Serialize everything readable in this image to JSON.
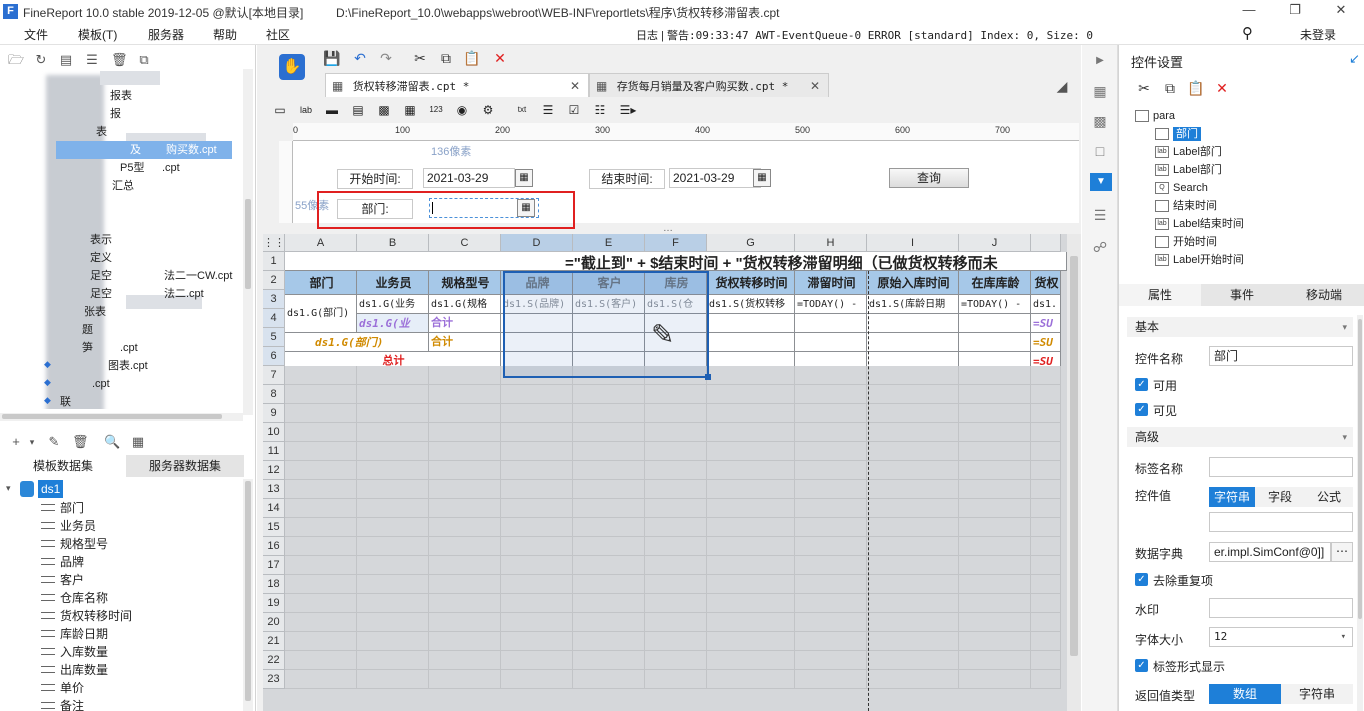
{
  "window": {
    "title": "FineReport 10.0 stable 2019-12-05 @默认[本地目录]",
    "path": "D:\\FineReport_10.0\\webapps\\webroot\\WEB-INF\\reportlets\\程序\\货权转移滞留表.cpt",
    "min_icon": "minimize-icon",
    "max_icon": "maximize-icon",
    "close_icon": "close-icon"
  },
  "menu": {
    "items": [
      "文件",
      "模板(T)",
      "服务器",
      "帮助",
      "社区"
    ],
    "log_label": "日志",
    "log_text": "警告:09:33:47 AWT-EventQueue-0 ERROR [standard] Index: 0, Size: 0",
    "login": "未登录"
  },
  "left": {
    "tree_items": [
      "报表",
      "报",
      "表",
      "及",
      "购买数.cpt",
      "P5型",
      ".cpt",
      "汇总",
      "表示",
      "定义",
      "足空",
      "法二一CW.cpt",
      "足空",
      "法二.cpt",
      "张表",
      "题",
      "笋",
      ".cpt",
      "图表.cpt",
      ".cpt",
      "联"
    ],
    "dataset_tabs": [
      "模板数据集",
      "服务器数据集"
    ],
    "dataset_name": "ds1",
    "fields": [
      "部门",
      "业务员",
      "规格型号",
      "品牌",
      "客户",
      "仓库名称",
      "货权转移时间",
      "库龄日期",
      "入库数量",
      "出库数量",
      "单价",
      "备注"
    ]
  },
  "tabs": [
    {
      "label": "货权转移滞留表.cpt *",
      "active": true
    },
    {
      "label": "存货每月销量及客户购买数.cpt *",
      "active": false
    }
  ],
  "ruler": {
    "marks": [
      "0",
      "100",
      "200",
      "300",
      "400",
      "500",
      "600",
      "700"
    ]
  },
  "params": {
    "hint_top": "136像素",
    "hint_left": "55像素",
    "start_label": "开始时间:",
    "start_value": "2021-03-29",
    "end_label": "结束时间:",
    "end_value": "2021-03-29",
    "query_button": "查询",
    "dept_label": "部门:",
    "dept_value": ""
  },
  "grid": {
    "columns": [
      "A",
      "B",
      "C",
      "D",
      "E",
      "F",
      "G",
      "H",
      "I",
      "J"
    ],
    "rows": [
      "1",
      "2",
      "3",
      "4",
      "5",
      "6",
      "7",
      "8",
      "9",
      "10",
      "11",
      "12",
      "13",
      "14",
      "15",
      "16",
      "17",
      "18",
      "19",
      "20",
      "21",
      "22",
      "23"
    ],
    "title_formula": "=\"截止到\" + $结束时间 + \"货权转移滞留明细（已做货权转移而未",
    "headers": [
      "部门",
      "业务员",
      "规格型号",
      "品牌",
      "客户",
      "库房",
      "货权转移时间",
      "滞留时间",
      "原始入库时间",
      "在库库龄",
      "货权"
    ],
    "row3": [
      "ds1.G(部门)",
      "ds1.G(业务",
      "ds1.G(规格",
      "ds1.S(品牌)",
      "ds1.S(客户)",
      "ds1.S(仓",
      "ds1.S(货权转移",
      "=TODAY() -",
      "ds1.S(库龄日期",
      "=TODAY() -",
      "ds1."
    ],
    "row4": [
      "ds1.G(业",
      "合计",
      "=SU"
    ],
    "row5": [
      "ds1.G(部门)",
      "合计",
      "=SU"
    ],
    "row6": [
      "总计",
      "=SU"
    ]
  },
  "right": {
    "title": "控件设置",
    "widget_tree": [
      "para",
      "部门",
      "Label部门",
      "Label部门",
      "Search",
      "结束时间",
      "Label结束时间",
      "开始时间",
      "Label开始时间"
    ],
    "prop_tabs": [
      "属性",
      "事件",
      "移动端"
    ],
    "section_basic": "基本",
    "widget_name_label": "控件名称",
    "widget_name": "部门",
    "enabled": "可用",
    "visible": "可见",
    "section_advanced": "高级",
    "label_name": "标签名称",
    "widget_value": "控件值",
    "value_types": [
      "字符串",
      "字段",
      "公式"
    ],
    "dict_label": "数据字典",
    "dict_value": "er.impl.SimConf@0]]",
    "dedupe": "去除重复项",
    "watermark": "水印",
    "font_size_label": "字体大小",
    "font_size": "12",
    "label_style": "标签形式显示",
    "return_type_label": "返回值类型",
    "return_types": [
      "数组",
      "字符串"
    ]
  },
  "colors": {
    "accent": "#1e7fd8",
    "header_fill": "#a6c8e8",
    "selection": "#1e5fb3",
    "red_box": "#e02020"
  }
}
